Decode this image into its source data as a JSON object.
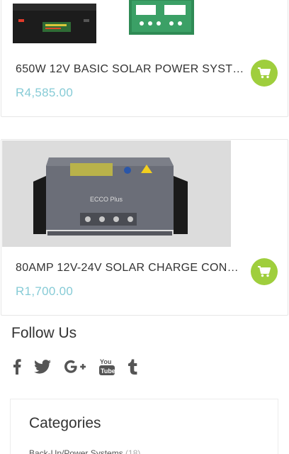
{
  "products": [
    {
      "title": "650W 12V BASIC SOLAR POWER SYST…",
      "price": "R4,585.00",
      "image_alt": "battery-and-inverter-product-image",
      "cart_icon": "shopping-cart-icon"
    },
    {
      "title": "80AMP 12V-24V SOLAR CHARGE CON…",
      "price": "R1,700.00",
      "image_alt": "solar-charge-controller-product-image",
      "cart_icon": "shopping-cart-icon",
      "device_label": "ECCO Plus"
    }
  ],
  "follow": {
    "heading": "Follow Us",
    "icons": [
      "facebook-icon",
      "twitter-icon",
      "google-plus-icon",
      "youtube-icon",
      "tumblr-icon"
    ]
  },
  "categories": {
    "heading": "Categories",
    "items": [
      {
        "label": "Back-Up/Power Systems",
        "count": "(18)"
      }
    ]
  },
  "colors": {
    "price": "#86cbd6",
    "cart_button": "#9fce3d",
    "text": "#333333"
  }
}
